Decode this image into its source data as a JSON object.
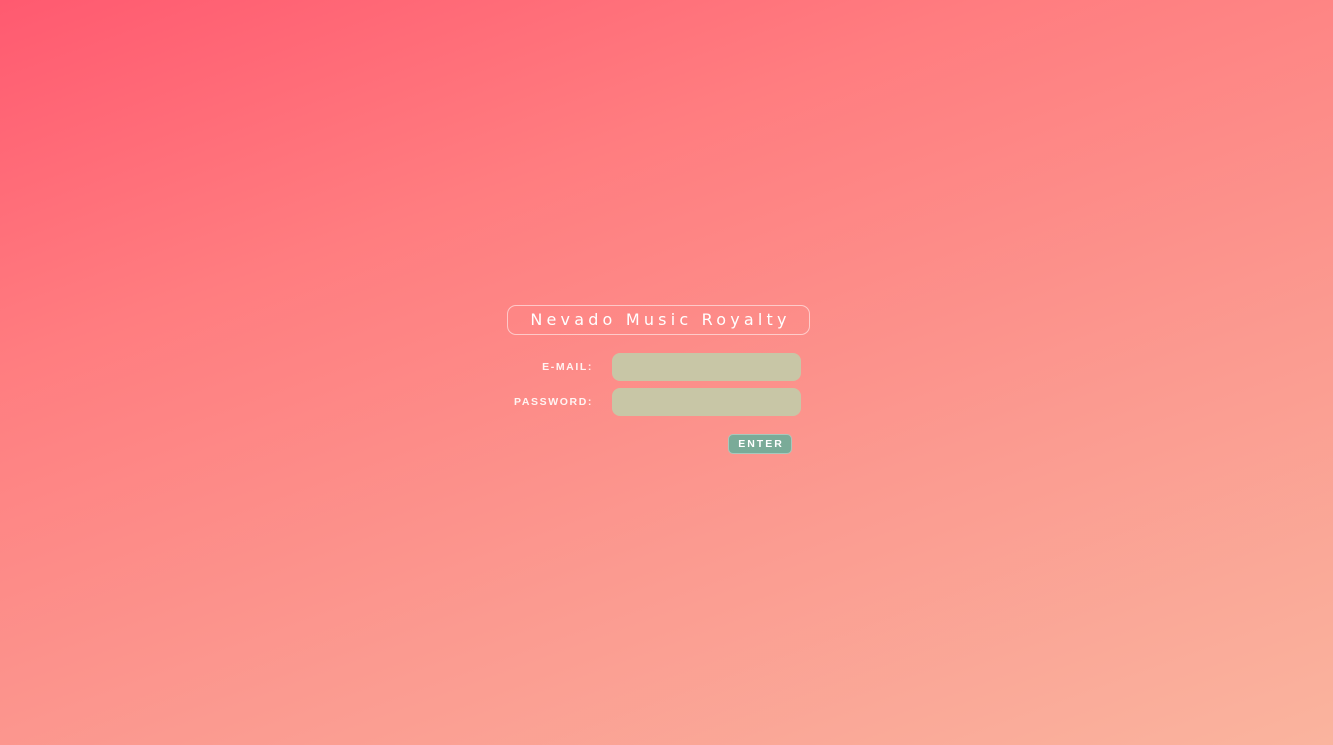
{
  "login": {
    "title": "Nevado Music Royalty",
    "email_label": "E-MAIL:",
    "email_value": "",
    "password_label": "PASSWORD:",
    "password_value": "",
    "enter_label": "ENTER"
  },
  "colors": {
    "background_start": "#ff5a70",
    "background_end": "#fab49e",
    "input_fill": "#c8c6a6",
    "button_fill": "#7aab98",
    "text": "#ffffff"
  }
}
